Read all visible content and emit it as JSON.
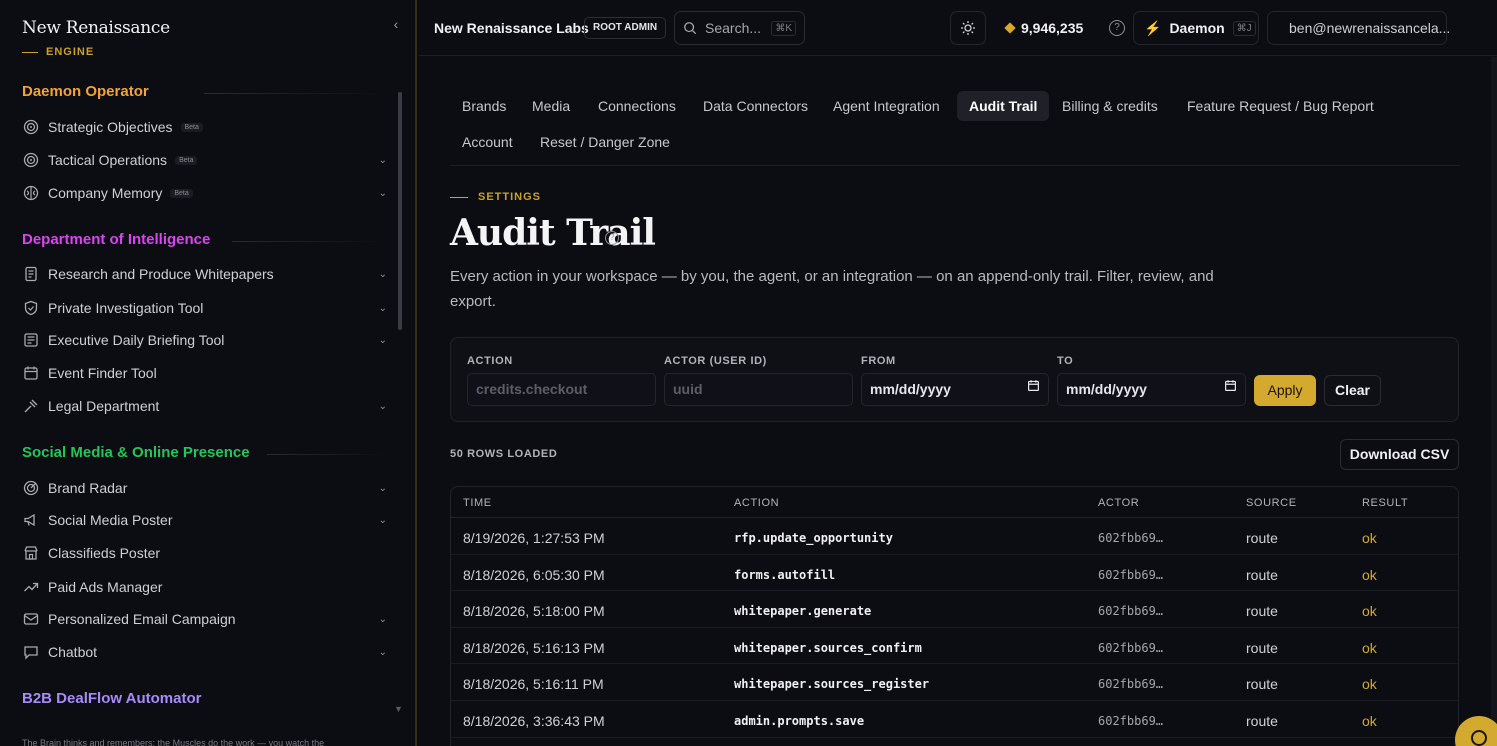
{
  "sidebar": {
    "brand_name": "New Renaissance",
    "brand_sub": "ENGINE",
    "sections": [
      {
        "title": "Daemon Operator",
        "color": "#f2a33a",
        "items": [
          {
            "label": "Strategic Objectives",
            "icon": "target-icon",
            "beta": "Beta",
            "chevron": false
          },
          {
            "label": "Tactical Operations",
            "icon": "target-icon",
            "beta": "Beta",
            "chevron": true
          },
          {
            "label": "Company Memory",
            "icon": "brain-icon",
            "beta": "Beta",
            "chevron": true
          }
        ]
      },
      {
        "title": "Department of Intelligence",
        "color": "#d946ef",
        "items": [
          {
            "label": "Research and Produce Whitepapers",
            "icon": "document-icon",
            "beta": "",
            "chevron": true
          },
          {
            "label": "Private Investigation Tool",
            "icon": "shield-icon",
            "beta": "",
            "chevron": true
          },
          {
            "label": "Executive Daily Briefing Tool",
            "icon": "newspaper-icon",
            "beta": "",
            "chevron": true
          },
          {
            "label": "Event Finder Tool",
            "icon": "calendar-icon",
            "beta": "",
            "chevron": false
          },
          {
            "label": "Legal Department",
            "icon": "gavel-icon",
            "beta": "",
            "chevron": true
          }
        ]
      },
      {
        "title": "Social Media & Online Presence",
        "color": "#22c55e",
        "items": [
          {
            "label": "Brand Radar",
            "icon": "radar-icon",
            "beta": "",
            "chevron": true
          },
          {
            "label": "Social Media Poster",
            "icon": "megaphone-icon",
            "beta": "",
            "chevron": true
          },
          {
            "label": "Classifieds Poster",
            "icon": "store-icon",
            "beta": "",
            "chevron": false
          },
          {
            "label": "Paid Ads Manager",
            "icon": "trending-up-icon",
            "beta": "",
            "chevron": false
          },
          {
            "label": "Personalized Email Campaign",
            "icon": "mail-icon",
            "beta": "",
            "chevron": true
          },
          {
            "label": "Chatbot",
            "icon": "chat-icon",
            "beta": "",
            "chevron": true
          }
        ]
      },
      {
        "title": "B2B DealFlow Automator",
        "color": "#a78bfa",
        "items": []
      }
    ],
    "footer_text": "The Brain thinks and remembers; the Muscles do the work — you watch the"
  },
  "topbar": {
    "org_name": "New Renaissance Labs",
    "role_badge": "ROOT ADMIN",
    "search_placeholder": "Search...",
    "search_kbd": "⌘K",
    "credits": "9,946,235",
    "daemon_label": "Daemon",
    "daemon_kbd": "⌘J",
    "user_email": "ben@newrenaissancela..."
  },
  "tabs": [
    {
      "label": "Brands",
      "active": false
    },
    {
      "label": "Media",
      "active": false
    },
    {
      "label": "Connections",
      "active": false
    },
    {
      "label": "Data Connectors",
      "active": false
    },
    {
      "label": "Agent Integration",
      "active": false
    },
    {
      "label": "Audit Trail",
      "active": true
    },
    {
      "label": "Billing & credits",
      "active": false
    },
    {
      "label": "Feature Request / Bug Report",
      "active": false
    },
    {
      "label": "Account",
      "active": false
    },
    {
      "label": "Reset / Danger Zone",
      "active": false
    }
  ],
  "page": {
    "eyebrow": "SETTINGS",
    "title": "Audit Trail",
    "subtitle": "Every action in your workspace — by you, the agent, or an integration — on an append-only trail. Filter, review, and export."
  },
  "filters": {
    "action_label": "ACTION",
    "action_placeholder": "credits.checkout",
    "actor_label": "ACTOR (USER ID)",
    "actor_placeholder": "uuid",
    "from_label": "FROM",
    "from_value": "mm/dd/yyyy",
    "to_label": "TO",
    "to_value": "mm/dd/yyyy",
    "apply_label": "Apply",
    "clear_label": "Clear"
  },
  "results": {
    "rows_loaded": "50 ROWS LOADED",
    "download_label": "Download CSV",
    "columns": [
      "TIME",
      "ACTION",
      "ACTOR",
      "SOURCE",
      "RESULT"
    ],
    "rows": [
      {
        "time": "8/19/2026, 1:27:53 PM",
        "action": "rfp.update_opportunity",
        "actor": "602fbb69…",
        "source": "route",
        "result": "ok"
      },
      {
        "time": "8/18/2026, 6:05:30 PM",
        "action": "forms.autofill",
        "actor": "602fbb69…",
        "source": "route",
        "result": "ok"
      },
      {
        "time": "8/18/2026, 5:18:00 PM",
        "action": "whitepaper.generate",
        "actor": "602fbb69…",
        "source": "route",
        "result": "ok"
      },
      {
        "time": "8/18/2026, 5:16:13 PM",
        "action": "whitepaper.sources_confirm",
        "actor": "602fbb69…",
        "source": "route",
        "result": "ok"
      },
      {
        "time": "8/18/2026, 5:16:11 PM",
        "action": "whitepaper.sources_register",
        "actor": "602fbb69…",
        "source": "route",
        "result": "ok"
      },
      {
        "time": "8/18/2026, 3:36:43 PM",
        "action": "admin.prompts.save",
        "actor": "602fbb69…",
        "source": "route",
        "result": "ok"
      }
    ]
  },
  "colors": {
    "accent": "#d4aa2e",
    "background": "#0c0d12"
  }
}
